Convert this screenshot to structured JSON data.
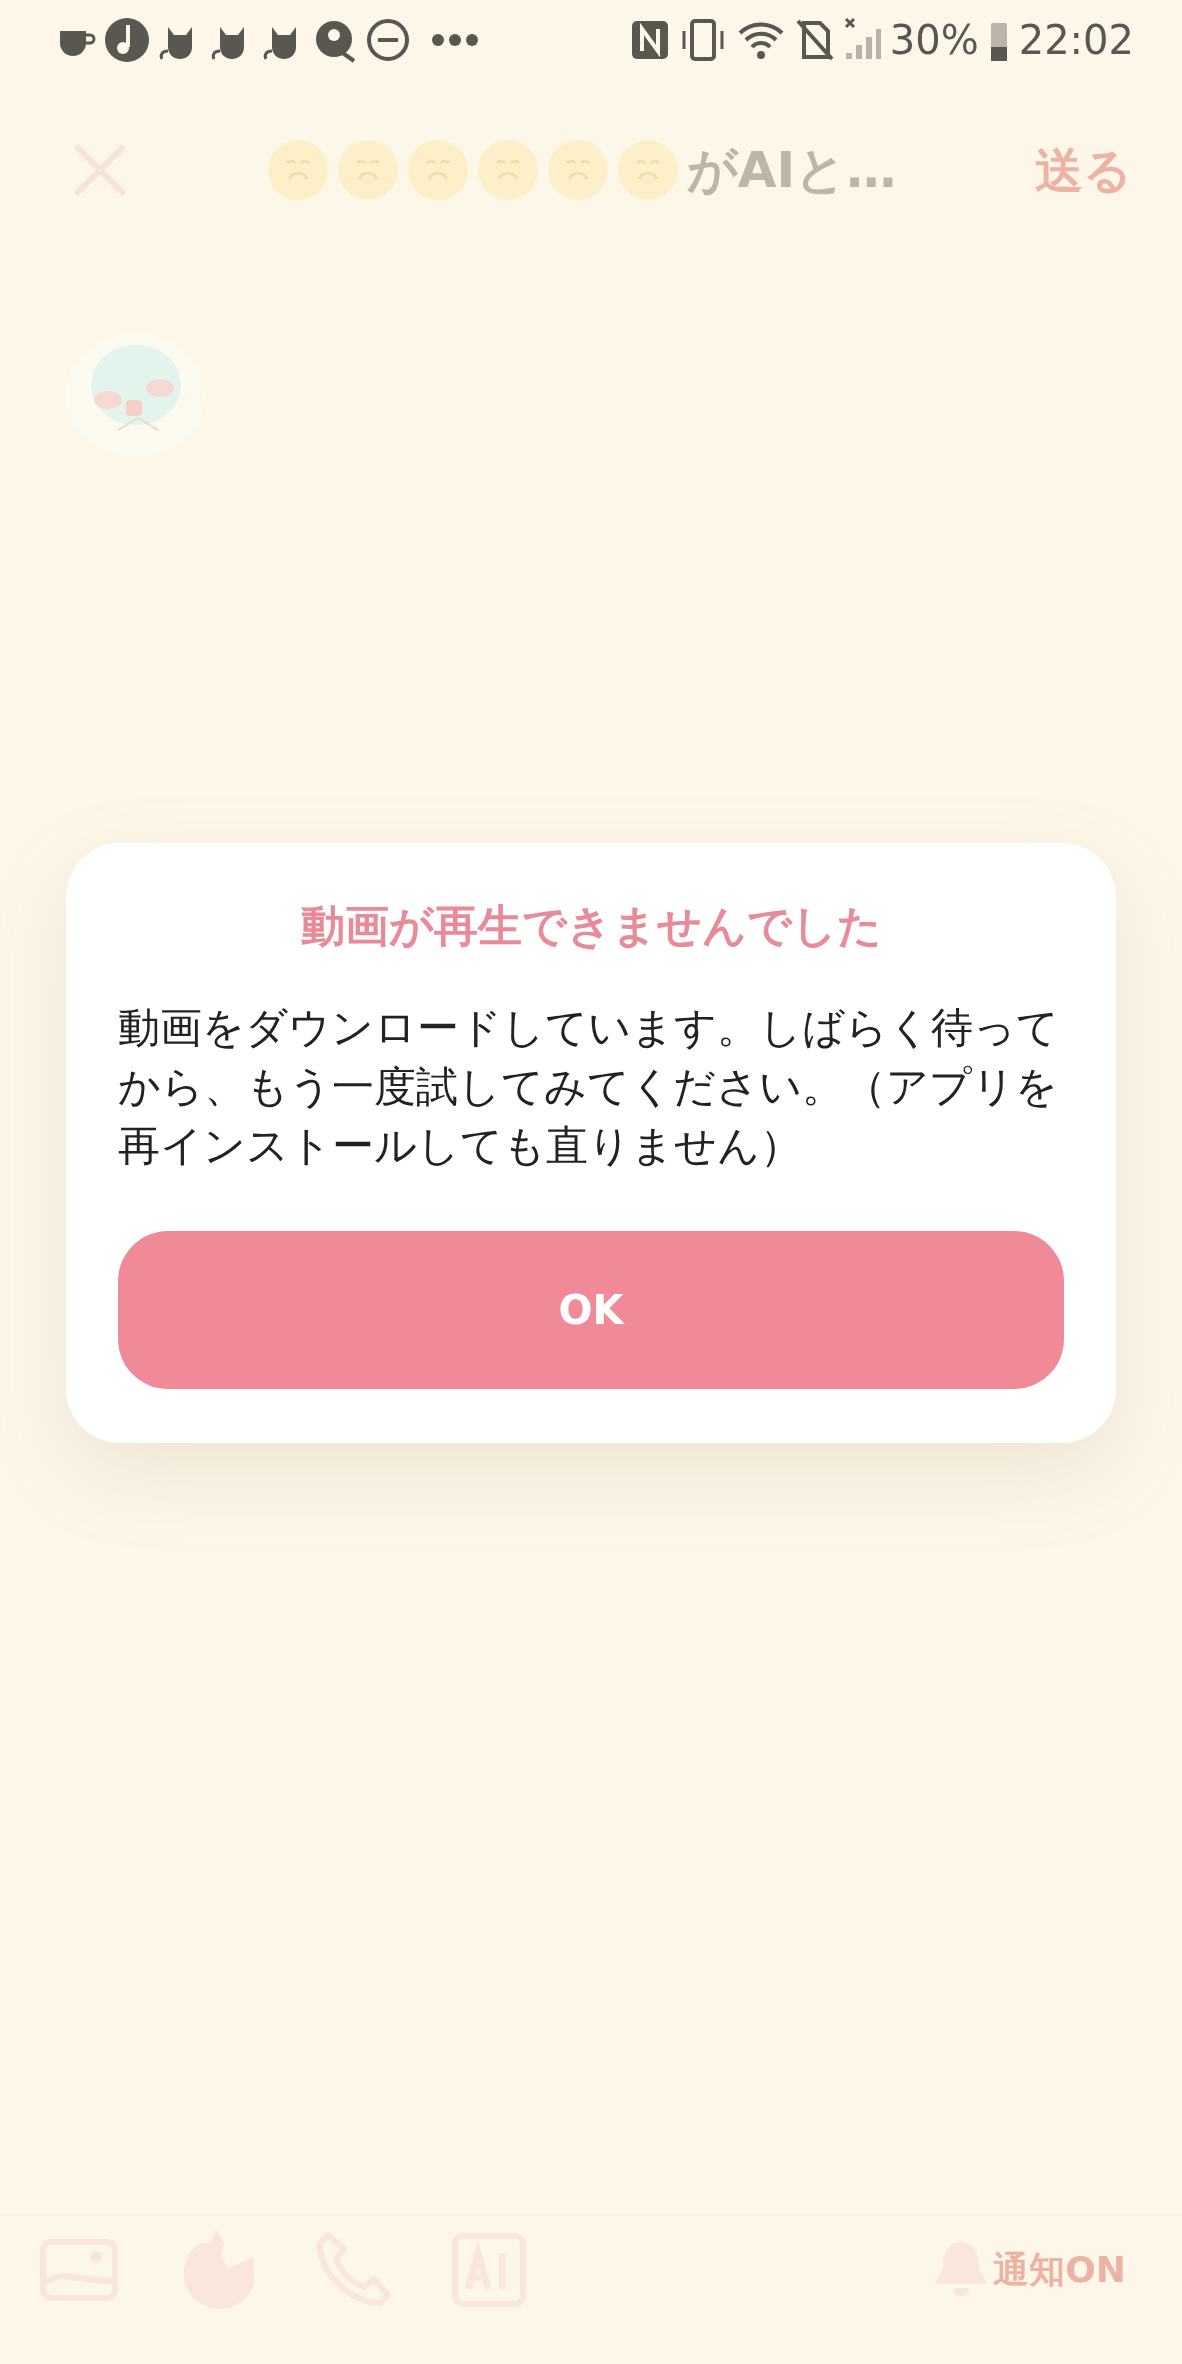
{
  "status_bar": {
    "battery": "30%",
    "time": "22:02"
  },
  "header": {
    "title": "がAIと…",
    "send": "送る"
  },
  "dialog": {
    "title": "動画が再生できませんでした",
    "message": "動画をダウンロードしています。しばらく待ってから、もう一度試してみてください。（アプリを再インストールしても直りません）",
    "button": "OK"
  },
  "toolbar": {
    "notify": "通知ON"
  }
}
